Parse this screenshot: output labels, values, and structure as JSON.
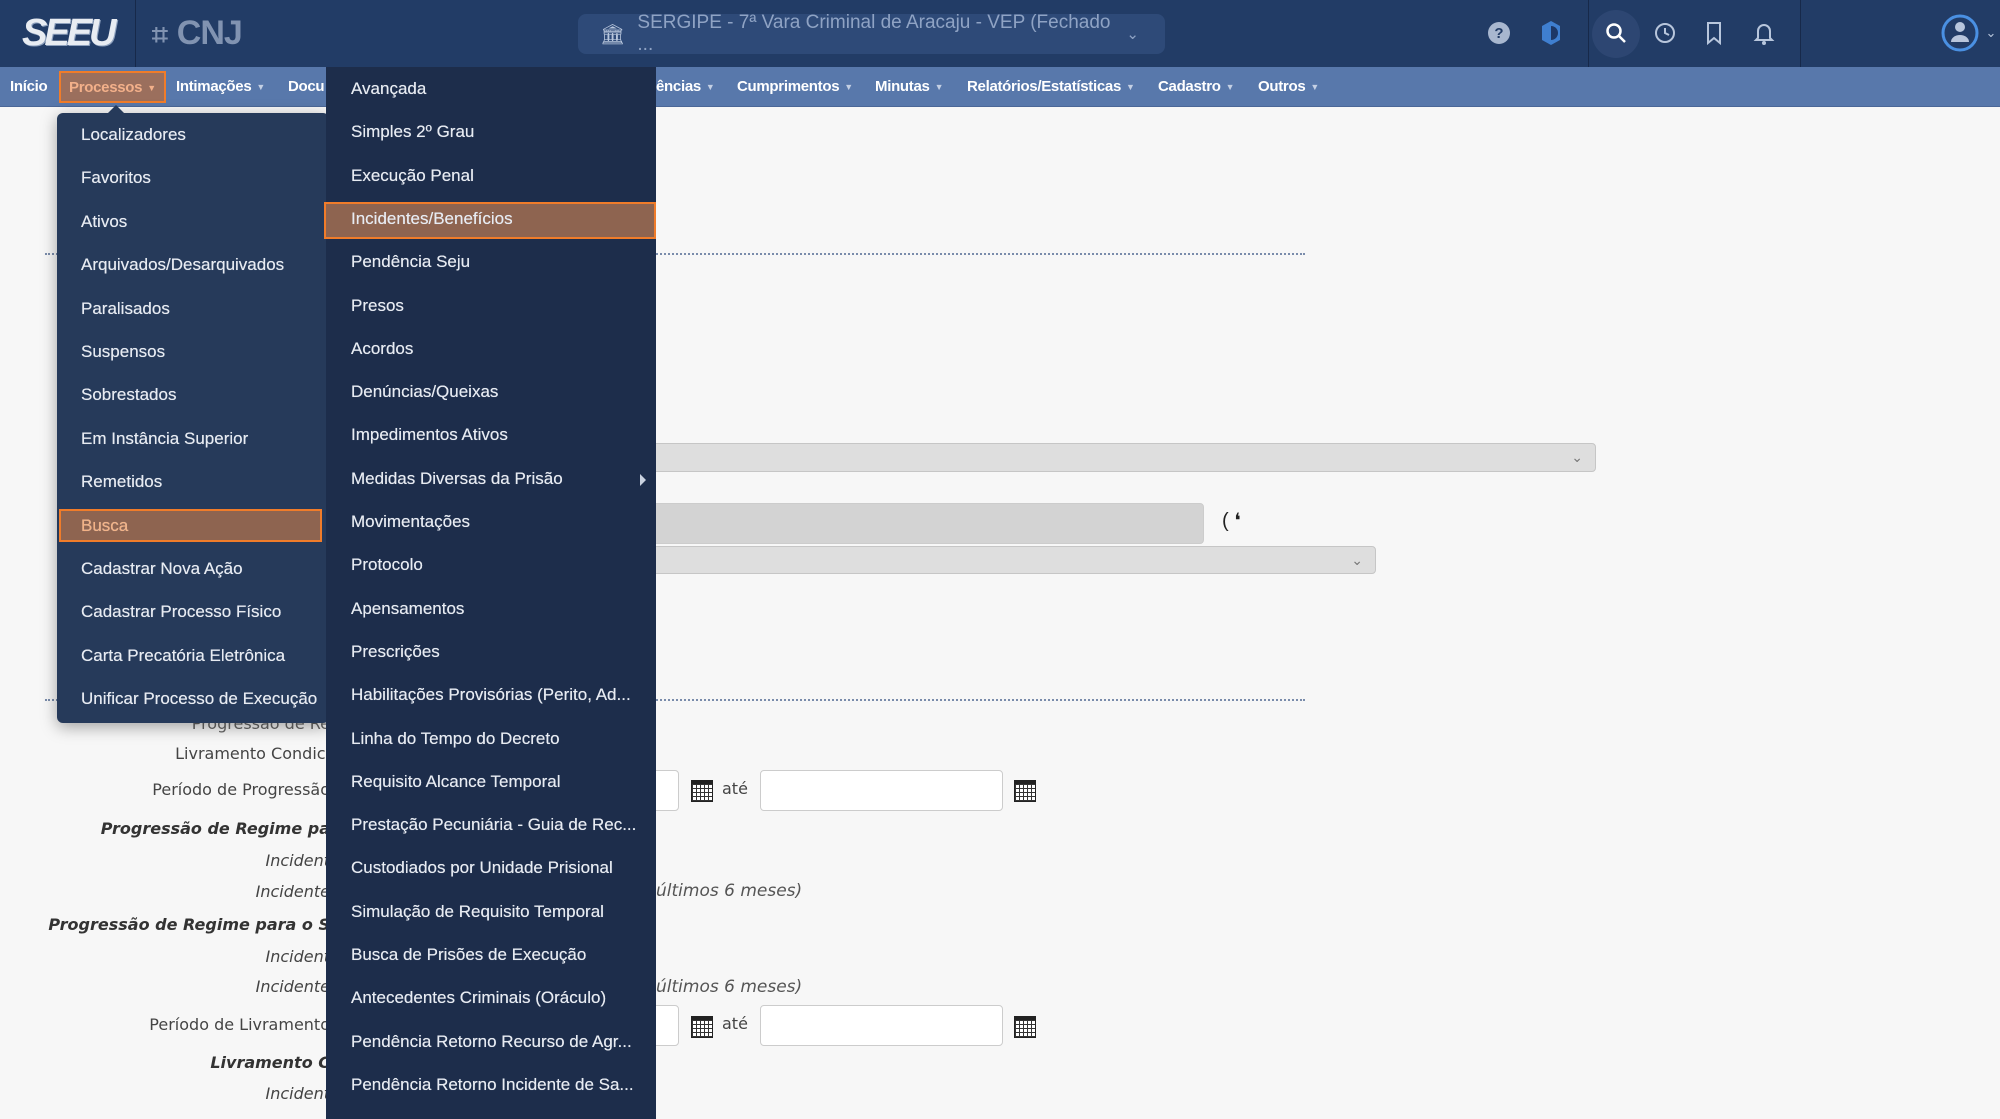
{
  "header": {
    "logo": "SEEU",
    "partner_logo": "CNJ",
    "location": "SERGIPE - 7ª Vara Criminal de Aracaju - VEP (Fechado ...",
    "icons": [
      "help-icon",
      "theme-icon",
      "search-icon",
      "history-icon",
      "bookmark-icon",
      "bell-icon",
      "avatar-icon"
    ]
  },
  "nav": {
    "items": [
      "Início",
      "Processos",
      "Intimações",
      "Docu",
      "ências",
      "Cumprimentos",
      "Minutas",
      "Relatórios/Estatísticas",
      "Cadastro",
      "Outros"
    ],
    "active": "Processos"
  },
  "processos_menu": {
    "items": [
      "Localizadores",
      "Favoritos",
      "Ativos",
      "Arquivados/Desarquivados",
      "Paralisados",
      "Suspensos",
      "Sobrestados",
      "Em Instância Superior",
      "Remetidos",
      "Busca",
      "Cadastrar Nova Ação",
      "Cadastrar Processo Físico",
      "Carta Precatória Eletrônica",
      "Unificar Processo de Execução"
    ],
    "active": "Busca"
  },
  "busca_submenu": {
    "items": [
      "Avançada",
      "Simples 2º Grau",
      "Execução Penal",
      "Incidentes/Benefícios",
      "Pendência Seju",
      "Presos",
      "Acordos",
      "Denúncias/Queixas",
      "Impedimentos Ativos",
      "Medidas Diversas da Prisão",
      "Movimentações",
      "Protocolo",
      "Apensamentos",
      "Prescrições",
      "Habilitações Provisórias (Perito, Ad...",
      "Linha do Tempo do Decreto",
      "Requisito Alcance Temporal",
      "Prestação Pecuniária - Guia de Rec...",
      "Custodiados por Unidade Prisional",
      "Simulação de Requisito Temporal",
      "Busca de Prisões de Execução",
      "Antecedentes Criminais (Oráculo)",
      "Pendência Retorno Recurso de Agr...",
      "Pendência Retorno Incidente de Sa..."
    ],
    "active": "Incidentes/Benefícios"
  },
  "form": {
    "labels": [
      "Progressão de Re",
      "Livramento Condici",
      "Período de Progressão",
      "Progressão de Regime pa",
      "Incident",
      "Incidente",
      "Progressão de Regime para o S",
      "Incident",
      "Incidente",
      "Período de Livramento",
      "Livramento C",
      "Incident"
    ],
    "hint": "últimos 6 meses)",
    "ate": "até"
  },
  "colors": {
    "header": "#223c66",
    "nav": "#5878ab",
    "menu": "#263a5a",
    "submenu": "#1d2d4b",
    "highlight_border": "#f07c2a"
  }
}
